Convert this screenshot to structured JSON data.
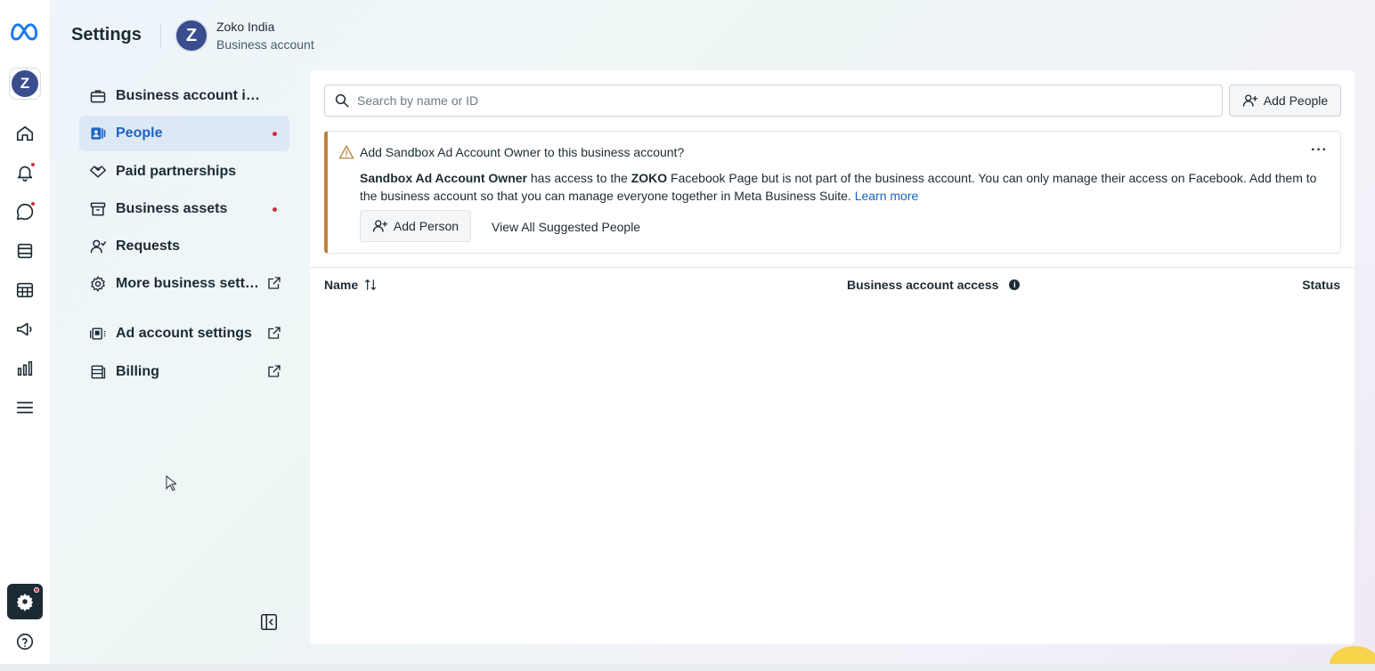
{
  "header": {
    "title": "Settings",
    "account_name": "Zoko India",
    "account_type": "Business account",
    "avatar_letter": "Z"
  },
  "rail": {
    "items": [
      "meta-logo-icon",
      "home-icon",
      "notifications-icon",
      "messages-icon",
      "content-icon",
      "planner-icon",
      "ads-icon",
      "insights-icon",
      "menu-icon",
      "settings-icon",
      "help-icon"
    ]
  },
  "nav": {
    "items": [
      {
        "label": "Business account info",
        "icon": "briefcase-icon"
      },
      {
        "label": "People",
        "icon": "people-icon",
        "active": true,
        "dot": true
      },
      {
        "label": "Paid partnerships",
        "icon": "handshake-icon"
      },
      {
        "label": "Business assets",
        "icon": "archive-icon",
        "dot": true
      },
      {
        "label": "Requests",
        "icon": "person-request-icon"
      },
      {
        "label": "More business settings",
        "display": "More business sett…",
        "icon": "gear-icon",
        "external": true
      },
      {
        "label": "Ad account settings",
        "icon": "ad-account-icon",
        "external": true
      },
      {
        "label": "Billing",
        "icon": "billing-icon",
        "external": true
      }
    ]
  },
  "main": {
    "search_placeholder": "Search by name or ID",
    "add_people_label": "Add People",
    "notice": {
      "title": "Add Sandbox Ad Account Owner to this business account?",
      "body_bold_1": "Sandbox Ad Account Owner",
      "body_text_1": " has access to the ",
      "body_bold_2": "ZOKO",
      "body_text_2": " Facebook Page but is not part of the business account. You can only manage their access on Facebook. Add them to the business account so that you can manage everyone together in Meta Business Suite. ",
      "learn_more": "Learn more",
      "add_person_label": "Add Person",
      "view_all_label": "View All Suggested People",
      "more_label": "···"
    },
    "table": {
      "col_name": "Name",
      "col_access": "Business account access",
      "col_status": "Status",
      "info_glyph": "i"
    }
  },
  "colors": {
    "accent": "#1a64c4",
    "active_bg": "#dde8f7",
    "alert_dot": "#c8323d",
    "warning_border": "#c0813f",
    "avatar": "#3a4d8f"
  }
}
